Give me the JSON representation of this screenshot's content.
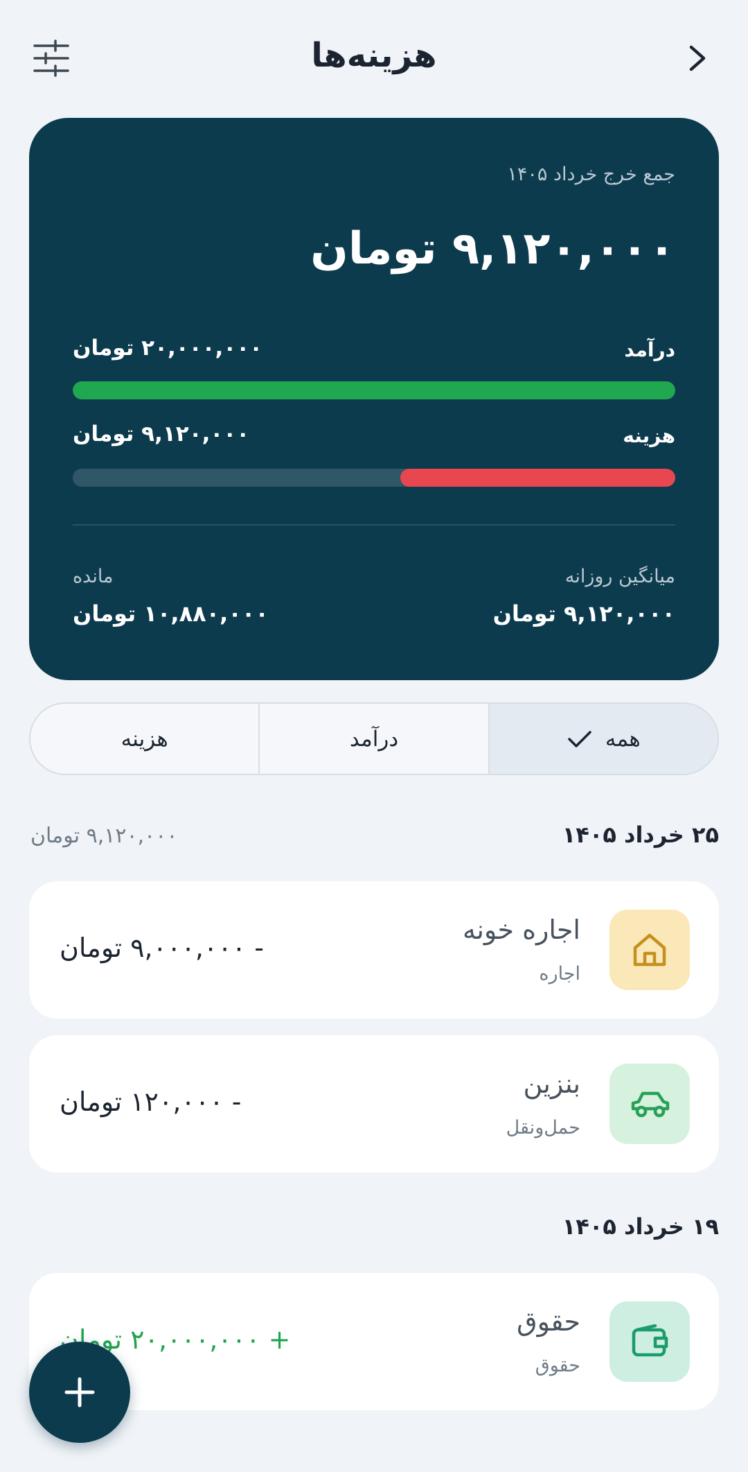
{
  "header": {
    "title": "هزینه‌ها",
    "filter_icon": "sliders-icon",
    "back_icon": "chevron-right-icon"
  },
  "summary": {
    "caption": "جمع خرج خرداد ۱۴۰۵",
    "total": "۹,۱۲۰,۰۰۰ تومان",
    "income_label": "درآمد",
    "income_amount": "۲۰,۰۰۰,۰۰۰ تومان",
    "income_fraction": 1.0,
    "expense_label": "هزینه",
    "expense_amount": "۹,۱۲۰,۰۰۰ تومان",
    "expense_fraction": 0.456,
    "daily_avg_label": "میانگین روزانه",
    "daily_avg_value": "۹,۱۲۰,۰۰۰ تومان",
    "remaining_label": "مانده",
    "remaining_value": "۱۰,۸۸۰,۰۰۰ تومان",
    "colors": {
      "card": "#0d3b4e",
      "income": "#1fa84f",
      "expense": "#e8474f"
    }
  },
  "tabs": [
    {
      "label": "همه",
      "active": true
    },
    {
      "label": "درآمد",
      "active": false
    },
    {
      "label": "هزینه",
      "active": false
    }
  ],
  "groups": [
    {
      "date": "۲۵ خرداد ۱۴۰۵",
      "total": "۹,۱۲۰,۰۰۰ تومان",
      "items": [
        {
          "name": "اجاره خونه",
          "category": "اجاره",
          "amount": "- ۹,۰۰۰,۰۰۰ تومان",
          "type": "expense",
          "icon": "home-icon",
          "icon_bg": "#fbe8b8",
          "icon_color": "#c4901e"
        },
        {
          "name": "بنزین",
          "category": "حمل‌ونقل",
          "amount": "- ۱۲۰,۰۰۰ تومان",
          "type": "expense",
          "icon": "car-icon",
          "icon_bg": "#d6f1de",
          "icon_color": "#26a155"
        }
      ]
    },
    {
      "date": "۱۹ خرداد ۱۴۰۵",
      "items": [
        {
          "name": "حقوق",
          "category": "حقوق",
          "amount": "+ ۲۰,۰۰۰,۰۰۰ تومان",
          "type": "income",
          "icon": "wallet-icon",
          "icon_bg": "#cdeee0",
          "icon_color": "#1a9c6b"
        }
      ]
    }
  ],
  "fab": {
    "icon": "plus-icon"
  }
}
